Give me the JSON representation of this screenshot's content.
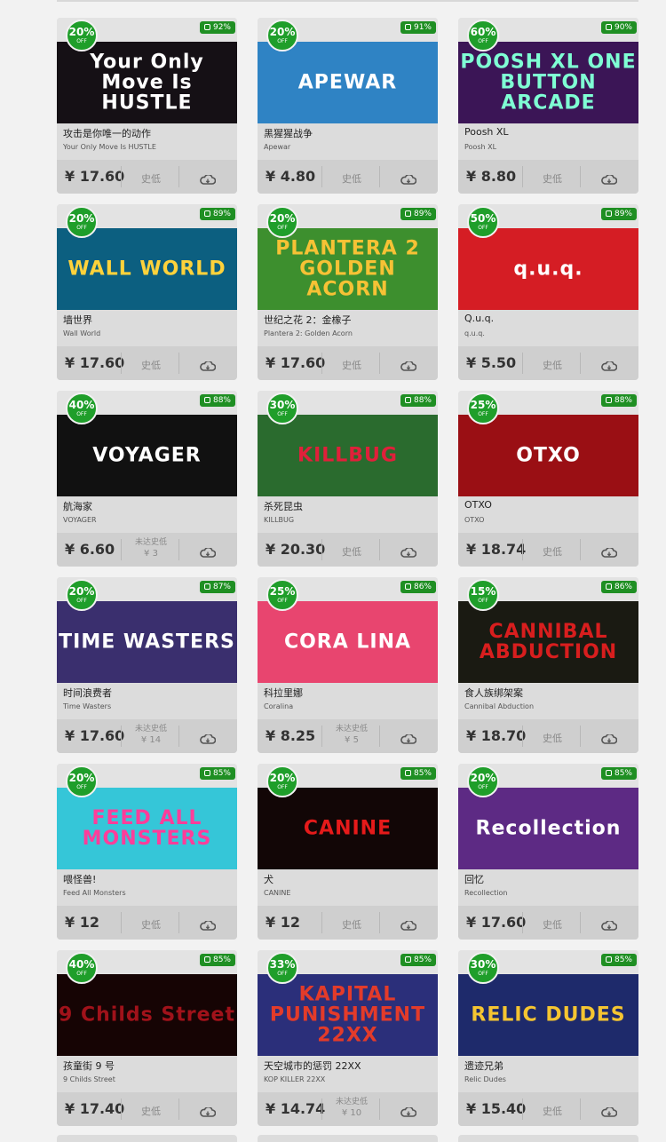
{
  "badge_off": "OFF",
  "cards": [
    {
      "discount": "20%",
      "rating": "92%",
      "name_cn": "攻击是你唯一的动作",
      "name_en": "Your Only Move Is HUSTLE",
      "price": "¥ 17.60",
      "low": "史低",
      "art_text": "Your Only Move Is HUSTLE",
      "art_bg": "#151015",
      "art_fg": "#ffffff"
    },
    {
      "discount": "20%",
      "rating": "91%",
      "name_cn": "黑猩猩战争",
      "name_en": "Apewar",
      "price": "¥ 4.80",
      "low": "史低",
      "art_text": "APEWAR",
      "art_bg": "#2f83c4",
      "art_fg": "#ffffff"
    },
    {
      "discount": "60%",
      "rating": "90%",
      "name_cn": "Poosh XL",
      "name_en": "Poosh XL",
      "price": "¥ 8.80",
      "low": "史低",
      "art_text": "POOSH XL ONE BUTTON ARCADE",
      "art_bg": "#3b1556",
      "art_fg": "#7fffd4"
    },
    {
      "discount": "20%",
      "rating": "89%",
      "name_cn": "墙世界",
      "name_en": "Wall World",
      "price": "¥ 17.60",
      "low": "史低",
      "art_text": "WALL WORLD",
      "art_bg": "#0c5f80",
      "art_fg": "#ffd23b"
    },
    {
      "discount": "20%",
      "rating": "89%",
      "name_cn": "世纪之花 2：金橡子",
      "name_en": "Plantera 2: Golden Acorn",
      "price": "¥ 17.60",
      "low": "史低",
      "art_text": "PLANTERA 2 GOLDEN ACORN",
      "art_bg": "#3d8f2e",
      "art_fg": "#f6c235"
    },
    {
      "discount": "50%",
      "rating": "89%",
      "name_cn": "Q.u.q.",
      "name_en": "q.u.q.",
      "price": "¥ 5.50",
      "low": "史低",
      "art_text": "q.u.q.",
      "art_bg": "#d51d24",
      "art_fg": "#ffffff"
    },
    {
      "discount": "40%",
      "rating": "88%",
      "name_cn": "航海家",
      "name_en": "VOYAGER",
      "price": "¥ 6.60",
      "low": "",
      "low_line1": "未达史低",
      "low_line2": "¥ 3",
      "art_text": "VOYAGER",
      "art_bg": "#111111",
      "art_fg": "#ffffff"
    },
    {
      "discount": "30%",
      "rating": "88%",
      "name_cn": "杀死昆虫",
      "name_en": "KILLBUG",
      "price": "¥ 20.30",
      "low": "史低",
      "art_text": "KILLBUG",
      "art_bg": "#2a6b2e",
      "art_fg": "#e0203a"
    },
    {
      "discount": "25%",
      "rating": "88%",
      "name_cn": "OTXO",
      "name_en": "OTXO",
      "price": "¥ 18.74",
      "low": "史低",
      "art_text": "OTXO",
      "art_bg": "#9a0f14",
      "art_fg": "#ffffff"
    },
    {
      "discount": "20%",
      "rating": "87%",
      "name_cn": "时间浪费者",
      "name_en": "Time Wasters",
      "price": "¥ 17.60",
      "low": "",
      "low_line1": "未达史低",
      "low_line2": "¥ 14",
      "art_text": "TIME WASTERS",
      "art_bg": "#3a2f6e",
      "art_fg": "#ffffff"
    },
    {
      "discount": "25%",
      "rating": "86%",
      "name_cn": "科拉里娜",
      "name_en": "Coralina",
      "price": "¥ 8.25",
      "low": "",
      "low_line1": "未达史低",
      "low_line2": "¥ 5",
      "art_text": "CORA LINA",
      "art_bg": "#e8456f",
      "art_fg": "#ffffff"
    },
    {
      "discount": "15%",
      "rating": "86%",
      "name_cn": "食人族绑架案",
      "name_en": "Cannibal Abduction",
      "price": "¥ 18.70",
      "low": "史低",
      "art_text": "CANNIBAL ABDUCTION",
      "art_bg": "#1a1a12",
      "art_fg": "#d81e1e"
    },
    {
      "discount": "20%",
      "rating": "85%",
      "name_cn": "喂怪兽!",
      "name_en": "Feed All Monsters",
      "price": "¥ 12",
      "low": "史低",
      "art_text": "FEED ALL MONSTERS",
      "art_bg": "#35c6d8",
      "art_fg": "#ff3d9a"
    },
    {
      "discount": "20%",
      "rating": "85%",
      "name_cn": "犬",
      "name_en": "CANINE",
      "price": "¥ 12",
      "low": "史低",
      "art_text": "CANINE",
      "art_bg": "#120606",
      "art_fg": "#e51a1a"
    },
    {
      "discount": "20%",
      "rating": "85%",
      "name_cn": "回忆",
      "name_en": "Recollection",
      "price": "¥ 17.60",
      "low": "史低",
      "art_text": "Recollection",
      "art_bg": "#5d2a84",
      "art_fg": "#ffffff"
    },
    {
      "discount": "40%",
      "rating": "85%",
      "name_cn": "孩童街 9 号",
      "name_en": "9 Childs Street",
      "price": "¥ 17.40",
      "low": "史低",
      "art_text": "9 Childs Street",
      "art_bg": "#160404",
      "art_fg": "#a0121a"
    },
    {
      "discount": "33%",
      "rating": "85%",
      "name_cn": "天空城市的惩罚 22XX",
      "name_en": "KOP KILLER 22XX",
      "price": "¥ 14.74",
      "low": "",
      "low_line1": "未达史低",
      "low_line2": "¥ 10",
      "art_text": "KAPITAL PUNISHMENT 22XX",
      "art_bg": "#2b2f7a",
      "art_fg": "#e33b2a"
    },
    {
      "discount": "30%",
      "rating": "85%",
      "name_cn": "遗迹兄弟",
      "name_en": "Relic Dudes",
      "price": "¥ 15.40",
      "low": "史低",
      "art_text": "RELIC DUDES",
      "art_bg": "#1e2a6b",
      "art_fg": "#f5c531"
    }
  ]
}
